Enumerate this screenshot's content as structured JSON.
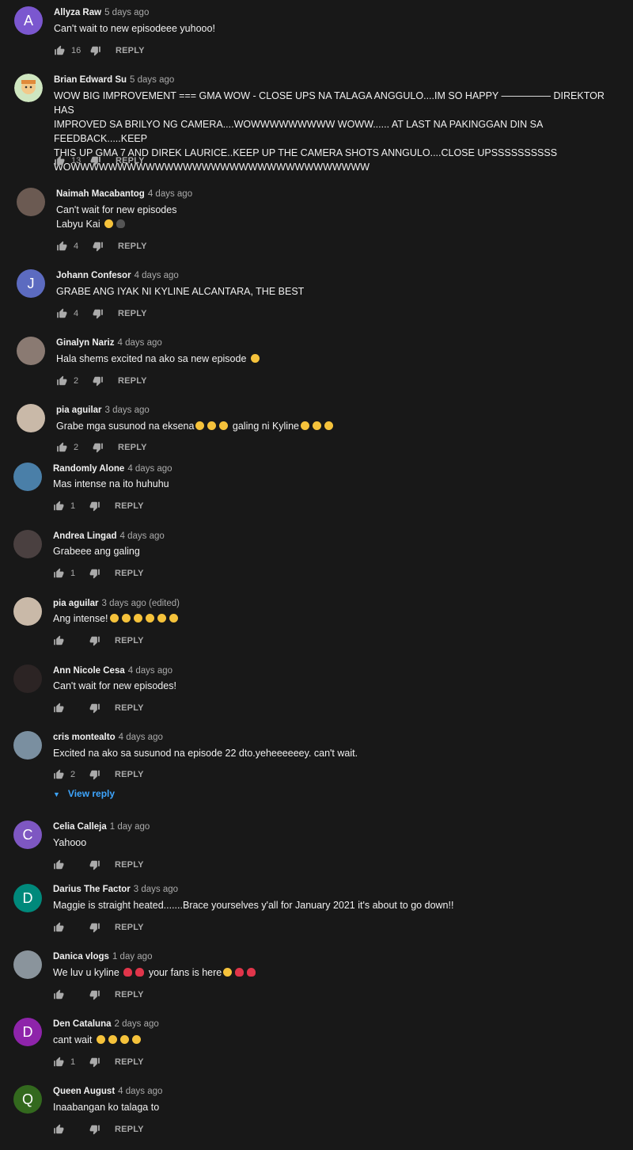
{
  "ui": {
    "reply_label": "REPLY"
  },
  "comments": [
    {
      "author": "Allyza Raw",
      "time": "5 days ago",
      "lines": [
        "Can't wait to new episodeee yuhooo!"
      ],
      "likes": "16",
      "avatar_letter": "A",
      "avatar_color": "#7b57cf"
    },
    {
      "author": "Brian Edward Su",
      "time": "5 days ago",
      "lines": [
        "WOW BIG IMPROVEMENT === GMA WOW - CLOSE UPS NA TALAGA ANGGULO....IM SO HAPPY ————— DIREKTOR HAS",
        "IMPROVED SA BRILYO NG CAMERA....WOWWWWWWWWW WOWW...... AT LAST NA PAKINGGAN DIN SA FEEDBACK.....KEEP",
        "THIS UP GMA 7 AND DIREK LAURICE..KEEP UP THE CAMERA SHOTS ANNGULO....CLOSE UPSSSSSSSSSS",
        "WOWWWWWWWWWWWWWWWWWWWWWWWWWWWWWWWW"
      ],
      "likes": "13",
      "avatar_letter": "",
      "avatar_color": "#9fcf88"
    },
    {
      "author": "Naimah Macabantog",
      "time": "4 days ago",
      "lines": [
        "Can't wait for new episodes",
        "Labyu Kai"
      ],
      "likes": "4",
      "avatar_letter": "",
      "avatar_color": "#6b5a52"
    },
    {
      "author": "Johann Confesor",
      "time": "4 days ago",
      "lines": [
        "GRABE ANG IYAK NI KYLINE ALCANTARA, THE BEST"
      ],
      "likes": "4",
      "avatar_letter": "J",
      "avatar_color": "#5c6bc0"
    },
    {
      "author": "Ginalyn Nariz",
      "time": "4 days ago",
      "lines": [
        "Hala shems excited na ako sa new episode"
      ],
      "likes": "2",
      "avatar_letter": "",
      "avatar_color": "#8a7a72"
    },
    {
      "author": "pia aguilar",
      "time": "3 days ago",
      "lines": [
        "Grabe mga susunod na eksena",
        "galing ni Kyline"
      ],
      "likes": "2",
      "avatar_letter": "",
      "avatar_color": "#c9b9a8"
    },
    {
      "author": "Randomly Alone",
      "time": "4 days ago",
      "lines": [
        "Mas intense na ito huhuhu"
      ],
      "likes": "1",
      "avatar_letter": "",
      "avatar_color": "#4a7fa8"
    },
    {
      "author": "Andrea Lingad",
      "time": "4 days ago",
      "lines": [
        "Grabeee ang galing"
      ],
      "likes": "1",
      "avatar_letter": "",
      "avatar_color": "#4a4040"
    },
    {
      "author": "pia aguilar",
      "time": "3 days ago (edited)",
      "lines": [
        "Ang intense!"
      ],
      "likes": "",
      "avatar_letter": "",
      "avatar_color": "#c9b9a8"
    },
    {
      "author": "Ann Nicole Cesa",
      "time": "4 days ago",
      "lines": [
        "Can't wait for new episodes!"
      ],
      "likes": "",
      "avatar_letter": "",
      "avatar_color": "#2c2424"
    },
    {
      "author": "cris montealto",
      "time": "4 days ago",
      "lines": [
        "Excited na ako sa susunod na episode 22 dto.yeheeeeeey. can't wait."
      ],
      "likes": "2",
      "avatar_letter": "",
      "avatar_color": "#7a8fa0",
      "view_reply": "View reply"
    },
    {
      "author": "Celia Calleja",
      "time": "1 day ago",
      "lines": [
        "Yahooo"
      ],
      "likes": "",
      "avatar_letter": "C",
      "avatar_color": "#7e57c2"
    },
    {
      "author": "Darius The Factor",
      "time": "3 days ago",
      "lines": [
        "Maggie is straight heated.......Brace yourselves y'all for January 2021 it's about to go down!!"
      ],
      "likes": "",
      "avatar_letter": "D",
      "avatar_color": "#00897b"
    },
    {
      "author": "Danica vlogs",
      "time": "1 day ago",
      "lines": [
        "We luv u kyline",
        "your fans is here"
      ],
      "likes": "",
      "avatar_letter": "",
      "avatar_color": "#8a949c"
    },
    {
      "author": "Den Cataluna",
      "time": "2 days ago",
      "lines": [
        "cant wait"
      ],
      "likes": "1",
      "avatar_letter": "D",
      "avatar_color": "#8e24aa"
    },
    {
      "author": "Queen August",
      "time": "4 days ago",
      "lines": [
        "Inaabangan ko talaga to"
      ],
      "likes": "",
      "avatar_letter": "Q",
      "avatar_color": "#33691e"
    }
  ]
}
